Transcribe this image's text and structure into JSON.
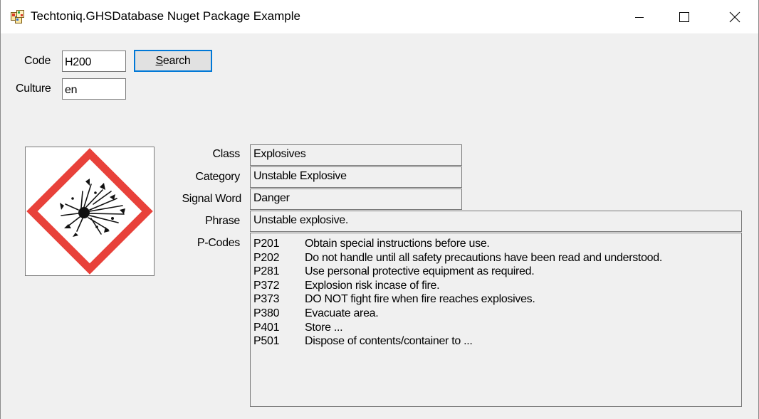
{
  "window": {
    "title": "Techtoniq.GHSDatabase Nuget Package Example"
  },
  "form": {
    "code_label": "Code",
    "code_value": "H200",
    "culture_label": "Culture",
    "culture_value": "en",
    "search_label": "Search"
  },
  "hazard": {
    "pictogram": "exploding-bomb-pictogram",
    "class_label": "Class",
    "class_value": "Explosives",
    "category_label": "Category",
    "category_value": "Unstable Explosive",
    "signal_word_label": "Signal Word",
    "signal_word_value": "Danger",
    "phrase_label": "Phrase",
    "phrase_value": "Unstable explosive.",
    "pcodes_label": "P-Codes",
    "pcodes": [
      {
        "code": "P201",
        "text": "Obtain special instructions before use."
      },
      {
        "code": "P202",
        "text": "Do not handle until all safety precautions have been read and understood."
      },
      {
        "code": "P281",
        "text": "Use personal protective equipment as required."
      },
      {
        "code": "P372",
        "text": "Explosion risk incase of fire."
      },
      {
        "code": "P373",
        "text": "DO NOT fight fire when fire reaches explosives."
      },
      {
        "code": "P380",
        "text": "Evacuate area."
      },
      {
        "code": "P401",
        "text": "Store ..."
      },
      {
        "code": "P501",
        "text": "Dispose of contents/container to ..."
      }
    ]
  },
  "colors": {
    "pictogram_border": "#e8413a",
    "focus_accent": "#0078d7",
    "window_bg": "#f0f0f0"
  }
}
